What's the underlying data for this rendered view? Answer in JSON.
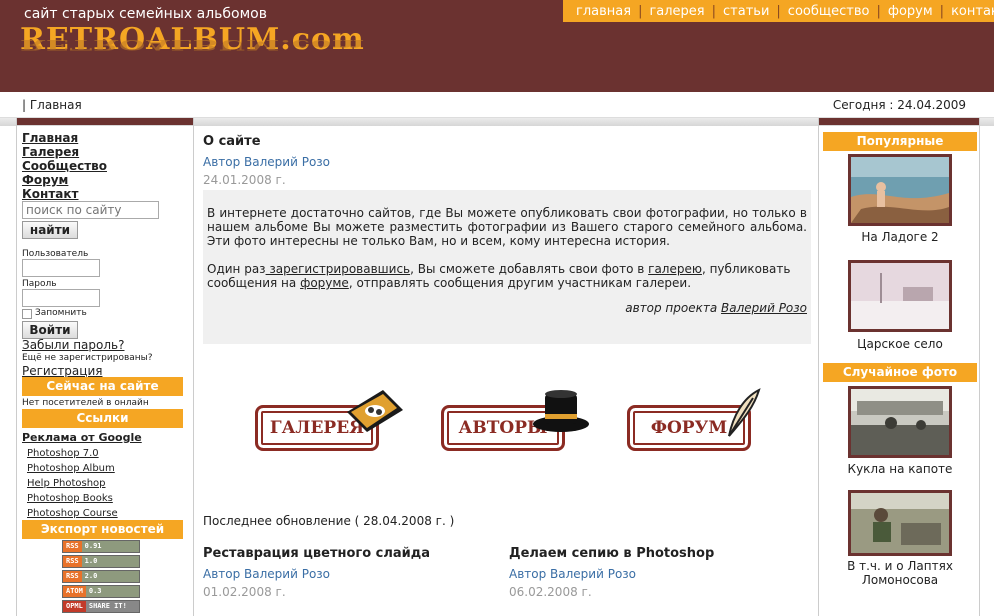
{
  "header": {
    "tagline": "сайт старых семейных альбомов",
    "logo": "RETROALBUM.com",
    "nav": [
      "главная",
      "галерея",
      "статьи",
      "сообщество",
      "форум",
      "контакт"
    ]
  },
  "breadcrumb": "| Главная",
  "today": "Сегодня : 24.04.2009",
  "left": {
    "menu": [
      "Главная",
      "Галерея",
      "Сообщество",
      "Форум",
      "Контакт"
    ],
    "search_placeholder": "поиск по сайту",
    "search_button": "найти",
    "user_label": "Пользователь",
    "password_label": "Пароль",
    "remember_label": "Запомнить",
    "login_button": "Войти",
    "forgot": "Забыли пароль?",
    "not_registered": "Ещё не зарегистрированы?",
    "register": "Регистрация",
    "online_title": "Сейчас на сайте",
    "online_text": "Нет посетителей в онлайн",
    "links_title": "Ссылки",
    "ad_title": "Реклама от Google",
    "ad_links": [
      "Photoshop 7.0",
      "Photoshop Album",
      "Help Photoshop",
      "Photoshop Books",
      "Photoshop Course"
    ],
    "export_title": "Экспорт новостей",
    "badges": [
      {
        "left": "RSS",
        "right": "0.91"
      },
      {
        "left": "RSS",
        "right": "1.0"
      },
      {
        "left": "RSS",
        "right": "2.0"
      },
      {
        "left": "ATOM",
        "right": "0.3"
      },
      {
        "left": "OPML",
        "right": "SHARE IT!"
      }
    ]
  },
  "article": {
    "title": "О сайте",
    "author": "Автор Валерий Розо",
    "date": "24.01.2008 г.",
    "p1": "В интернете достаточно сайтов, где Вы можете опубликовать свои фотографии, но только в нашем альбоме Вы можете разместить фотографии из Вашего старого семейного альбома. Эти фото интересны не только Вам, но и всем, кому интересна история.",
    "p2_a": "Один раз",
    "p2_link1": " зарегистрировавшись",
    "p2_b": ", Вы сможете добавлять свои фото в ",
    "p2_link2": "галерею",
    "p2_c": ", публиковать сообщения на ",
    "p2_link3": "форуме",
    "p2_d": ", отправлять сообщения другим участникам галереи.",
    "sign_prefix": "автор проекта ",
    "sign_name": "Валерий Розо"
  },
  "sections": [
    "ГАЛЕРЕЯ",
    "АВТОРЫ",
    "ФОРУМ"
  ],
  "last_update": "Последнее обновление ( 28.04.2008 г. )",
  "news": [
    {
      "title": "Реставрация цветного слайда",
      "author": "Автор Валерий Розо",
      "date": "01.02.2008 г."
    },
    {
      "title": "Делаем сепию в Photoshop",
      "author": "Автор Валерий Розо",
      "date": "06.02.2008 г."
    }
  ],
  "right": {
    "popular_title": "Популярные",
    "random_title": "Случайное фото",
    "photos": [
      "На Ладоге 2",
      "Царское село",
      "Кукла на капоте",
      "В т.ч. и о Лаптях Ломоносова"
    ]
  }
}
